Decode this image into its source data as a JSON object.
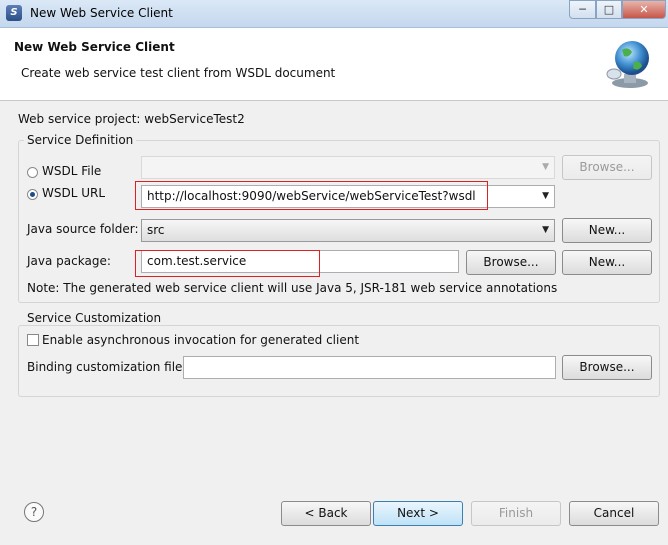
{
  "window": {
    "title": "New Web Service Client",
    "min_label": "─",
    "max_label": "□",
    "close_label": "✕"
  },
  "header": {
    "title": "New Web Service Client",
    "description": "Create web service test client from WSDL document"
  },
  "project": {
    "label": "Web service project: webServiceTest2"
  },
  "service_definition": {
    "group_title": "Service Definition",
    "wsdl_file_label": "WSDL File",
    "wsdl_file_value": "",
    "wsdl_file_browse": "Browse...",
    "wsdl_url_label": "WSDL URL",
    "wsdl_url_value": "http://localhost:9090/webService/webServiceTest?wsdl",
    "selected_option": "WSDL URL",
    "source_folder_label": "Java source folder:",
    "source_folder_value": "src",
    "source_folder_new": "New...",
    "package_label": "Java package:",
    "package_value": "com.test.service",
    "package_browse": "Browse...",
    "package_new": "New...",
    "note": "Note: The generated web service client will use Java 5, JSR-181 web service annotations"
  },
  "service_customization": {
    "group_title": "Service Customization",
    "async_label": "Enable asynchronous invocation for generated client",
    "async_checked": false,
    "binding_label": "Binding customization file:",
    "binding_value": "",
    "binding_browse": "Browse..."
  },
  "footer": {
    "help_icon_glyph": "?",
    "back": "< Back",
    "next": "Next >",
    "finish": "Finish",
    "cancel": "Cancel"
  },
  "colors": {
    "highlight_box": "#e02020",
    "accent": "#3c7fb1"
  }
}
